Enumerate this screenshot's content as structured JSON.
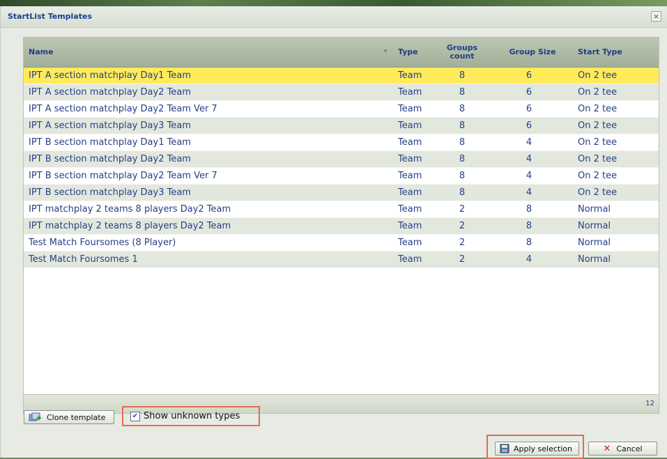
{
  "window": {
    "title": "StartList Templates"
  },
  "grid": {
    "columns": {
      "name": "Name",
      "type": "Type",
      "groups_count": "Groups count",
      "group_size": "Group Size",
      "start_type": "Start Type"
    },
    "rows": [
      {
        "name": "IPT A section matchplay Day1 Team",
        "type": "Team",
        "groups_count": "8",
        "group_size": "6",
        "start_type": "On 2 tee"
      },
      {
        "name": "IPT A section matchplay Day2 Team",
        "type": "Team",
        "groups_count": "8",
        "group_size": "6",
        "start_type": "On 2 tee"
      },
      {
        "name": "IPT A section matchplay Day2 Team Ver 7",
        "type": "Team",
        "groups_count": "8",
        "group_size": "6",
        "start_type": "On 2 tee"
      },
      {
        "name": "IPT A section matchplay Day3 Team",
        "type": "Team",
        "groups_count": "8",
        "group_size": "6",
        "start_type": "On 2 tee"
      },
      {
        "name": "IPT B section matchplay Day1 Team",
        "type": "Team",
        "groups_count": "8",
        "group_size": "4",
        "start_type": "On 2 tee"
      },
      {
        "name": "IPT B section matchplay Day2 Team",
        "type": "Team",
        "groups_count": "8",
        "group_size": "4",
        "start_type": "On 2 tee"
      },
      {
        "name": "IPT B section matchplay Day2 Team Ver 7",
        "type": "Team",
        "groups_count": "8",
        "group_size": "4",
        "start_type": "On 2 tee"
      },
      {
        "name": "IPT B section matchplay Day3 Team",
        "type": "Team",
        "groups_count": "8",
        "group_size": "4",
        "start_type": "On 2 tee"
      },
      {
        "name": "IPT matchplay 2 teams 8 players Day2 Team",
        "type": "Team",
        "groups_count": "2",
        "group_size": "8",
        "start_type": "Normal"
      },
      {
        "name": "IPT matchplay 2 teams 8 players Day2 Team",
        "type": "Team",
        "groups_count": "2",
        "group_size": "8",
        "start_type": "Normal"
      },
      {
        "name": "Test Match Foursomes (8 Player)",
        "type": "Team",
        "groups_count": "2",
        "group_size": "8",
        "start_type": "Normal"
      },
      {
        "name": "Test Match Foursomes 1",
        "type": "Team",
        "groups_count": "2",
        "group_size": "4",
        "start_type": "Normal"
      }
    ],
    "selected_row": 0,
    "record_count": "12"
  },
  "footer": {
    "clone_label": "Clone template",
    "show_unknown_label": "Show unknown types",
    "show_unknown_checked": true,
    "apply_label": "Apply selection",
    "cancel_label": "Cancel"
  },
  "icons": {
    "sort": "sort-arrow-icon",
    "clone": "clone-template-icon",
    "apply": "disk-icon",
    "cancel": "close-icon"
  },
  "colors": {
    "title": "#15428b",
    "selected_row": "#ffeb5a",
    "alt_row": "#e3e8de",
    "highlight_box": "#e46a52"
  }
}
